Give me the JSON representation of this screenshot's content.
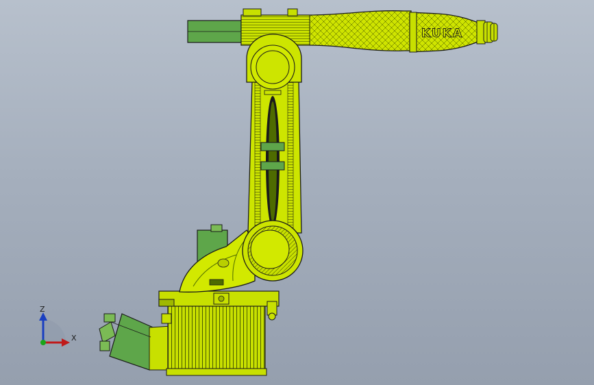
{
  "viewport": {
    "background_top": "#b7c0cc",
    "background_bottom": "#959fae"
  },
  "model": {
    "brand_text": "KUKA",
    "body_color": "#c8e000",
    "dark_accent_color": "#4e6b00",
    "motor_color": "#5ea64a",
    "outline_color": "#1a1a1a"
  },
  "triad": {
    "z_label": "Z",
    "x_label": "X",
    "z_color": "#1a3fc0",
    "x_color": "#c01a1a",
    "y_color": "#1aa51a"
  }
}
